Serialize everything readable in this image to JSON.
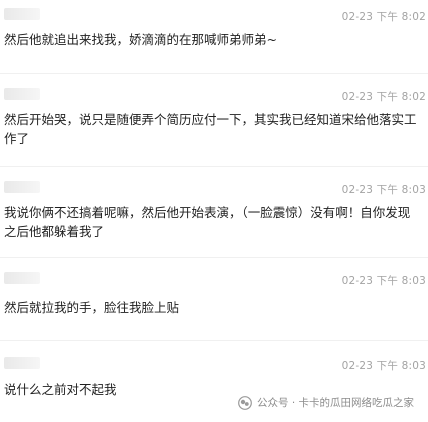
{
  "comments": [
    {
      "timestamp": "02-23 下午 8:02",
      "text": "然后他就追出来找我，娇滴滴的在那喊师弟师弟~"
    },
    {
      "timestamp": "02-23 下午 8:02",
      "text": "然后开始哭，说只是随便弄个简历应付一下，其实我已经知道宋给他落实工作了"
    },
    {
      "timestamp": "02-23 下午 8:03",
      "text": "我说你俩不还搞着呢嘛，然后他开始表演，（一脸震惊）没有啊！自你发现之后他都躲着我了"
    },
    {
      "timestamp": "02-23 下午 8:03",
      "text": "然后就拉我的手，脸往我脸上贴"
    },
    {
      "timestamp": "02-23 下午 8:03",
      "text": "说什么之前对不起我"
    }
  ],
  "watermark": {
    "text": "公众号 · 卡卡的瓜田网络吃瓜之家",
    "icon": "wechat-official-account-icon"
  },
  "colors": {
    "text": "#1f1f1f",
    "timestamp": "#a3a3a3",
    "watermark": "#8c8c8c",
    "divider": "#f0f0f0"
  }
}
